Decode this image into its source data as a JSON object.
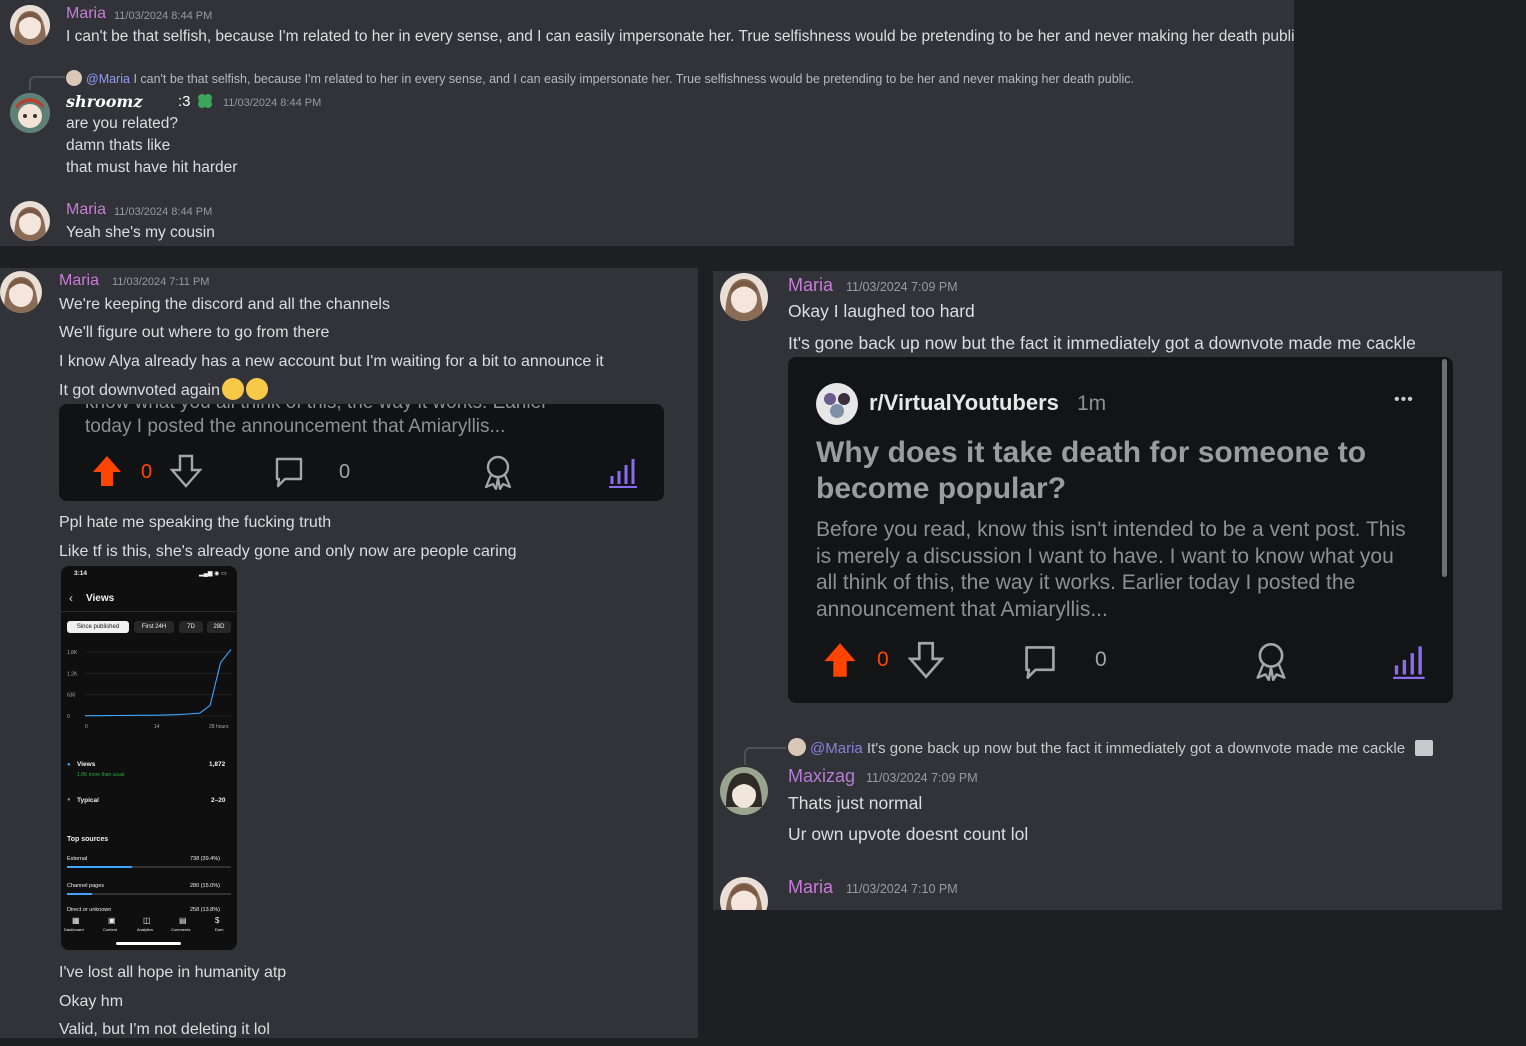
{
  "panel1": {
    "msg1": {
      "user": "Maria",
      "time": "11/03/2024 8:44 PM",
      "text": "I can't be that selfish, because I'm related to her in every sense, and I can easily impersonate her. True selfishness would be pretending to be her and never making her death public."
    },
    "reply": {
      "mention": "@Maria",
      "text": "I can't be that selfish, because I'm related to her in every sense, and I can easily impersonate her. True selfishness would be pretending to be her and never making her death public."
    },
    "msg2": {
      "user": "shroomz",
      "suffix": ":3",
      "time": "11/03/2024 8:44 PM",
      "lines": [
        "are you related?",
        "damn thats like",
        "that must have hit harder"
      ]
    },
    "msg3": {
      "user": "Maria",
      "time": "11/03/2024 8:44 PM",
      "text": "Yeah she's my cousin"
    }
  },
  "panel2": {
    "header": {
      "user": "Maria",
      "time": "11/03/2024 7:11 PM"
    },
    "lines": [
      "We're keeping the discord and all the channels",
      "We'll figure out where to go from there",
      "I know Alya already has a new account but I'm waiting for a bit to announce it",
      "It got downvoted again"
    ],
    "card": {
      "cut_line": "know what you all think of this, the way it works. Earlier",
      "last_line": "today I posted the announcement that Amiaryllis...",
      "votes": "0",
      "comments": "0"
    },
    "lines2": [
      "Ppl hate me speaking the fucking truth",
      "Like tf is this, she's already gone and only now are people caring"
    ],
    "phone": {
      "time": "3:14",
      "title": "Views",
      "chips": [
        "Since published",
        "First 24H",
        "7D",
        "28D"
      ],
      "y_ticks": [
        "1.8K",
        "1.2K",
        "630",
        "0"
      ],
      "x_ticks": [
        "0",
        "14",
        "28 hours"
      ],
      "views_label": "Views",
      "views_value": "1,872",
      "views_note": "1.8K more than usual",
      "typical_label": "Typical",
      "typical_value": "2–20",
      "top_sources": "Top sources",
      "sources": [
        {
          "name": "External",
          "value": "738 (39.4%)"
        },
        {
          "name": "Channel pages",
          "value": "280 (15.0%)"
        },
        {
          "name": "Direct or unknown",
          "value": "258 (13.8%)"
        }
      ],
      "nav": [
        "Dashboard",
        "Content",
        "Analytics",
        "Comments",
        "Earn"
      ],
      "chart_data": {
        "type": "line",
        "x": [
          0,
          2,
          4,
          6,
          8,
          10,
          12,
          14,
          16,
          18,
          20,
          22,
          24,
          26,
          28
        ],
        "values": [
          8,
          10,
          12,
          14,
          16,
          18,
          20,
          24,
          30,
          40,
          60,
          80,
          300,
          1500,
          1872
        ],
        "ylim": [
          0,
          1800
        ],
        "xlabel": "",
        "ylabel": ""
      }
    },
    "lines3": [
      "I've lost all hope in humanity atp",
      "Okay hm",
      "Valid, but I'm not deleting it lol"
    ]
  },
  "panel3": {
    "msg1": {
      "user": "Maria",
      "time": "11/03/2024 7:09 PM",
      "lines": [
        "Okay I laughed too hard",
        "It's gone back up now but the fact it immediately got a downvote made me cackle"
      ]
    },
    "card": {
      "subreddit": "r/VirtualYoutubers",
      "age": "1m",
      "more": "•••",
      "title": "Why does it take death for someone to become popular?",
      "body": "Before you read, know this isn't intended to be a vent post. This is merely a discussion I want to have. I want to know what you all think of this, the way it works. Earlier today I posted the announcement that Amiaryllis...",
      "votes": "0",
      "comments": "0"
    },
    "reply": {
      "mention": "@Maria",
      "text": "It's gone back up now but the fact it immediately got a downvote made me cackle"
    },
    "msg2": {
      "user": "Maxizag",
      "time": "11/03/2024 7:09 PM",
      "lines": [
        "Thats just normal",
        "Ur own upvote doesnt count lol"
      ]
    },
    "msg3": {
      "user": "Maria",
      "time": "11/03/2024 7:10 PM"
    }
  },
  "colors": {
    "maria": "#c77dd8",
    "bg": "#313338",
    "reddit_up": "#ff4500",
    "mention": "#949cf7"
  }
}
